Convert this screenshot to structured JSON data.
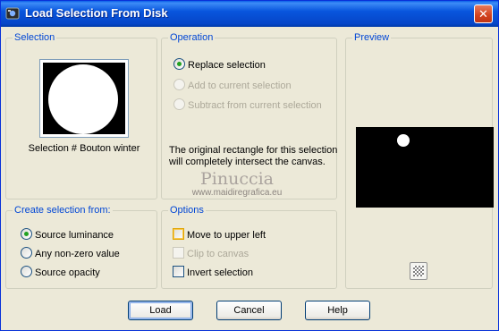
{
  "window": {
    "title": "Load Selection From Disk",
    "close_symbol": "✕"
  },
  "selection": {
    "label": "Selection",
    "caption": "Selection # Bouton winter"
  },
  "operation": {
    "label": "Operation",
    "options": [
      {
        "label": "Replace selection",
        "checked": true,
        "enabled": true
      },
      {
        "label": "Add to current selection",
        "checked": false,
        "enabled": false
      },
      {
        "label": "Subtract from current selection",
        "checked": false,
        "enabled": false
      }
    ],
    "info_text": "The original rectangle for this selection will completely intersect the canvas."
  },
  "preview": {
    "label": "Preview",
    "button_icon": "checkerboard-icon"
  },
  "watermark": {
    "name": "Pinuccia",
    "url": "www.maidiregrafica.eu"
  },
  "create_from": {
    "label": "Create selection from:",
    "options": [
      {
        "label": "Source luminance",
        "checked": true
      },
      {
        "label": "Any non-zero value",
        "checked": false
      },
      {
        "label": "Source opacity",
        "checked": false
      }
    ]
  },
  "options": {
    "label": "Options",
    "items": [
      {
        "label": "Move to upper left",
        "checked": false,
        "enabled": true
      },
      {
        "label": "Clip to canvas",
        "checked": false,
        "enabled": false
      },
      {
        "label": "Invert selection",
        "checked": false,
        "enabled": true
      }
    ]
  },
  "buttons": {
    "load": "Load",
    "cancel": "Cancel",
    "help": "Help"
  }
}
